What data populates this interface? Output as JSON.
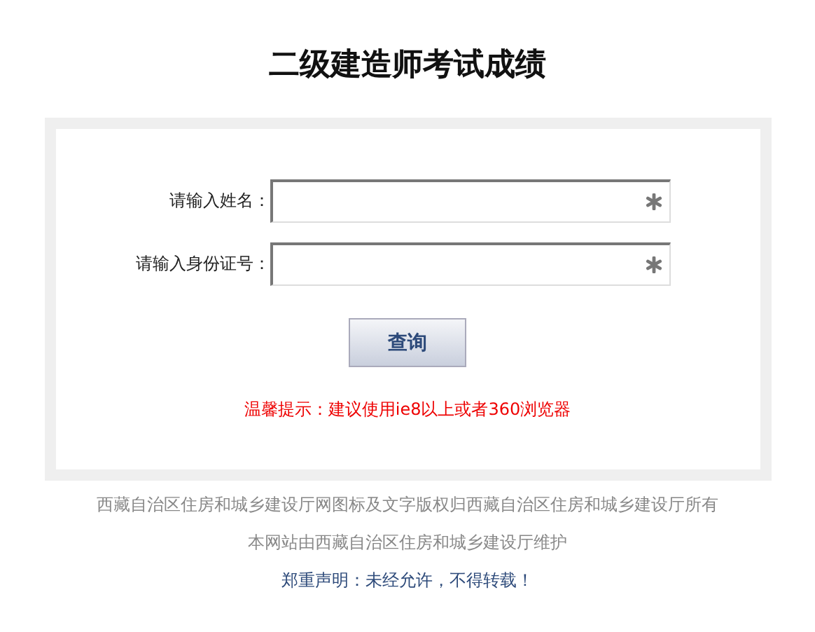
{
  "title": "二级建造师考试成绩",
  "fields": [
    {
      "label": "请输入姓名：",
      "required": true
    },
    {
      "label": "请输入身份证号：",
      "required": true
    }
  ],
  "submit_button": "查询",
  "hint": "温馨提示：建议使用ie8以上或者360浏览器",
  "footer": [
    {
      "text": "西藏自治区住房和城乡建设厅网图标及文字版权归西藏自治区住房和城乡建设厅所有",
      "kind": "muted"
    },
    {
      "text": "本网站由西藏自治区住房和城乡建设厅维护",
      "kind": "muted"
    },
    {
      "text": "郑重声明：未经允许，不得转载！",
      "kind": "notice"
    }
  ]
}
